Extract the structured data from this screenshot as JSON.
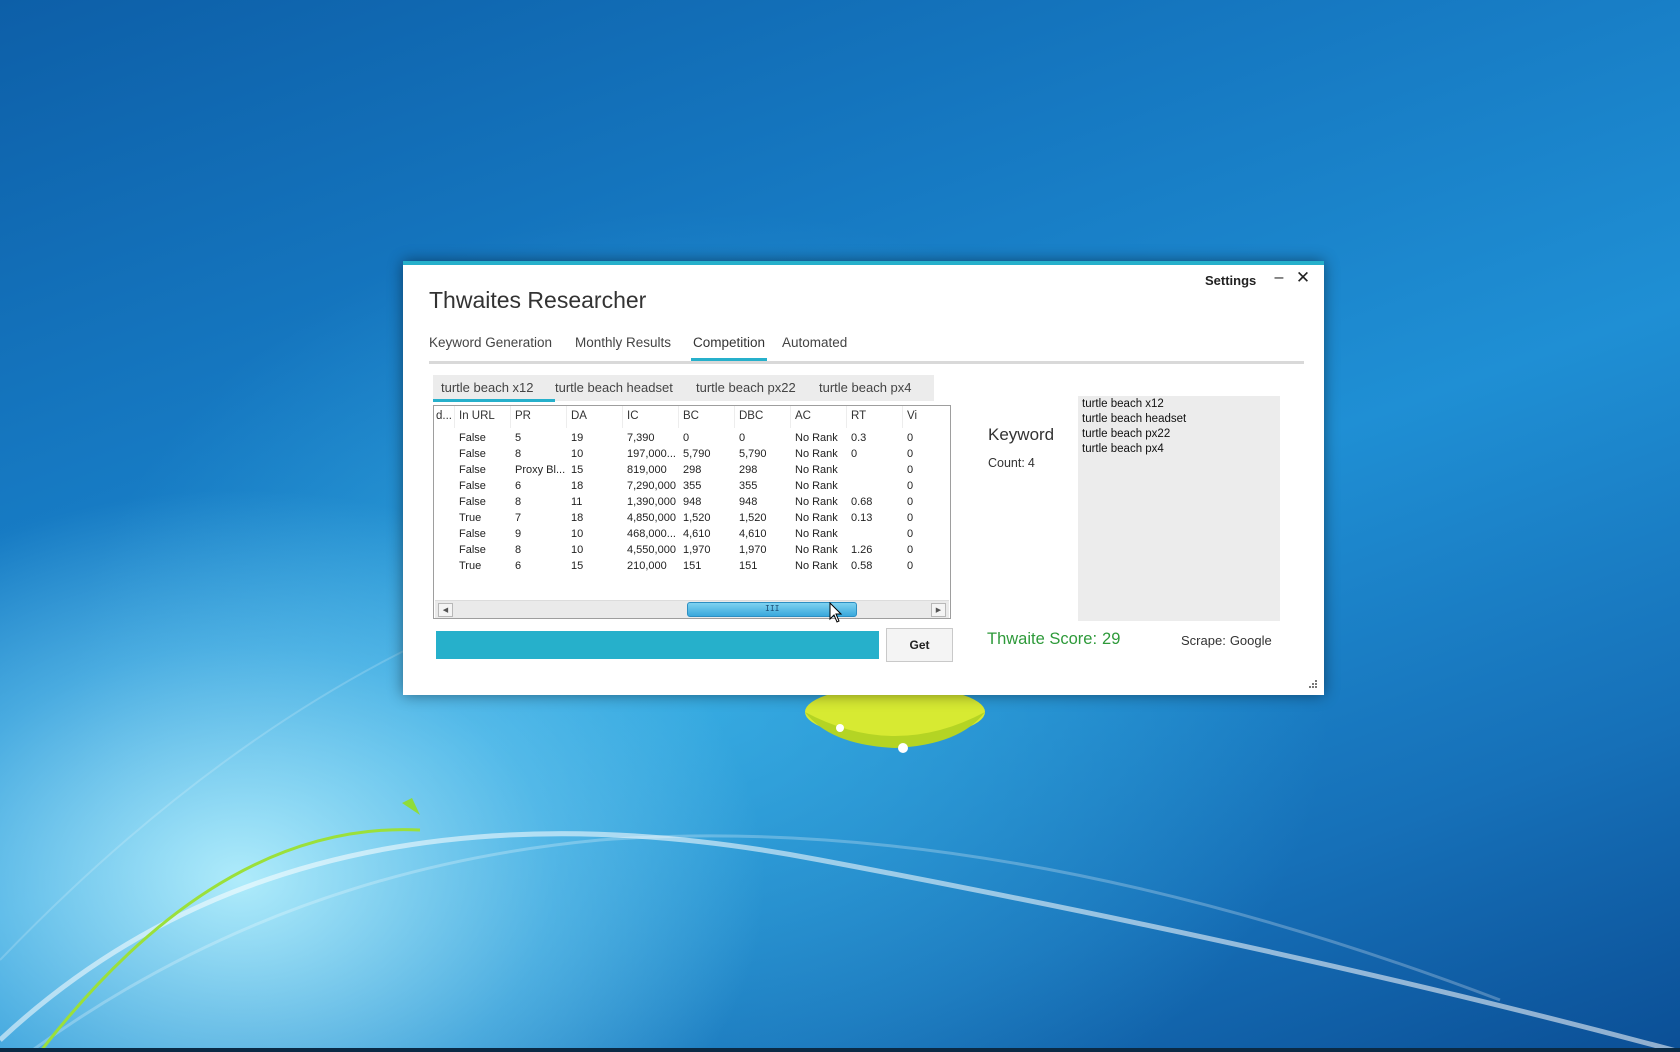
{
  "window": {
    "title": "Thwaites Researcher",
    "settings_label": "Settings",
    "minimize_label": "–",
    "close_label": "✕",
    "accent_color": "#26b0cb"
  },
  "main_tabs": [
    {
      "label": "Keyword Generation",
      "active": false
    },
    {
      "label": "Monthly Results",
      "active": false
    },
    {
      "label": "Competition",
      "active": true
    },
    {
      "label": "Automated",
      "active": false
    }
  ],
  "keyword_tabs": [
    {
      "label": "turtle beach x12",
      "active": true
    },
    {
      "label": "turtle beach headset",
      "active": false
    },
    {
      "label": "turtle beach px22",
      "active": false
    },
    {
      "label": "turtle beach px4",
      "active": false
    }
  ],
  "grid": {
    "columns": [
      "d...",
      "In URL",
      "PR",
      "DA",
      "IC",
      "BC",
      "DBC",
      "AC",
      "RT",
      "Vi"
    ],
    "rows": [
      [
        "",
        "False",
        "5",
        "19",
        "7,390",
        "0",
        "0",
        "No Rank",
        "0.3",
        "0"
      ],
      [
        "",
        "False",
        "8",
        "10",
        "197,000...",
        "5,790",
        "5,790",
        "No Rank",
        "0",
        "0"
      ],
      [
        "",
        "False",
        "Proxy Bl...",
        "15",
        "819,000",
        "298",
        "298",
        "No Rank",
        "",
        "0"
      ],
      [
        "",
        "False",
        "6",
        "18",
        "7,290,000",
        "355",
        "355",
        "No Rank",
        "",
        "0"
      ],
      [
        "",
        "False",
        "8",
        "11",
        "1,390,000",
        "948",
        "948",
        "No Rank",
        "0.68",
        "0"
      ],
      [
        "",
        "True",
        "7",
        "18",
        "4,850,000",
        "1,520",
        "1,520",
        "No Rank",
        "0.13",
        "0"
      ],
      [
        "",
        "False",
        "9",
        "10",
        "468,000...",
        "4,610",
        "4,610",
        "No Rank",
        "",
        "0"
      ],
      [
        "",
        "False",
        "8",
        "10",
        "4,550,000",
        "1,970",
        "1,970",
        "No Rank",
        "1.26",
        "0"
      ],
      [
        "",
        "True",
        "6",
        "15",
        "210,000",
        "151",
        "151",
        "No Rank",
        "0.58",
        "0"
      ]
    ],
    "scroll_grip": "III"
  },
  "actions": {
    "get_label": "Get"
  },
  "keyword_panel": {
    "label": "Keyword",
    "count_label": "Count:",
    "count_value": "4",
    "items": [
      "turtle beach x12",
      "turtle beach headset",
      "turtle beach px22",
      "turtle beach px4"
    ]
  },
  "footer": {
    "score_label": "Thwaite Score:",
    "score_value": "29",
    "score_color": "#2e9a3a",
    "scrape_label": "Scrape:",
    "scrape_value": "Google"
  }
}
